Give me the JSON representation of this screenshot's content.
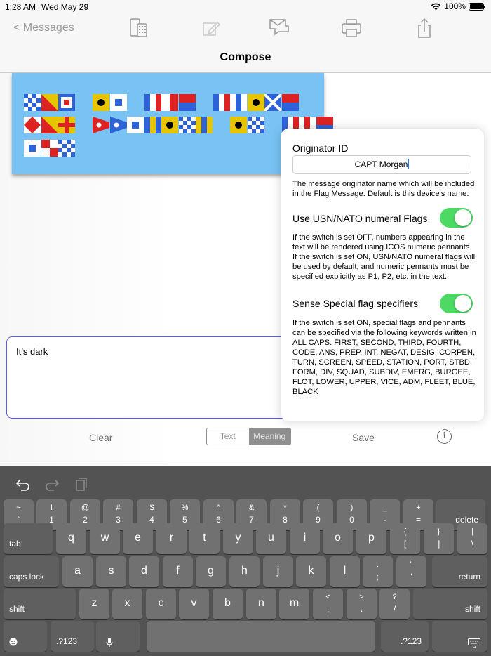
{
  "status": {
    "time": "1:28 AM",
    "date": "Wed May 29",
    "battery": "100%"
  },
  "nav": {
    "back": "< Messages",
    "title": "Compose"
  },
  "flags": [
    [
      [
        "diamond",
        "#2d62d8",
        "#fff"
      ],
      [
        "diagonal",
        "#e6c400",
        "#d22"
      ],
      [
        "squares",
        "#d22",
        "#fff"
      ],
      null,
      [
        "dot",
        "#e6c400",
        "#000"
      ],
      [
        "square",
        "#fff",
        "#2d62d8"
      ],
      null,
      [
        "vstripes3",
        "#2d62d8",
        "#fff",
        "#d22"
      ],
      [
        "vstripes2",
        "#fff",
        "#d22"
      ],
      [
        "halves",
        "#d22",
        "#2d62d8"
      ],
      null,
      [
        "vstripes3",
        "#2d62d8",
        "#fff",
        "#d22"
      ],
      [
        "vstripes3",
        "#fff",
        "#2d62d8",
        "#fff"
      ],
      [
        "dot",
        "#e6c400",
        "#000"
      ],
      [
        "saltire",
        "#2d62d8",
        "#fff"
      ],
      [
        "halves",
        "#d22",
        "#2d62d8"
      ]
    ],
    [
      [
        "diamond2",
        "#fff",
        "#d22"
      ],
      [
        "diagonal",
        "#e6c400",
        "#d22"
      ],
      [
        "cross",
        "#e6c400",
        "#d22"
      ],
      null,
      [
        "pennant",
        "#d22",
        "#fff"
      ],
      [
        "pennant",
        "#2d62d8",
        "#fff"
      ],
      [
        "square",
        "#fff",
        "#2d62d8"
      ],
      [
        "vstripes3",
        "#2d62d8",
        "#e6c400",
        "#2d62d8"
      ],
      [
        "dot",
        "#e6c400",
        "#000"
      ],
      [
        "diamond",
        "#2d62d8",
        "#fff"
      ],
      [
        "vstripes3",
        "#e6c400",
        "#2d62d8",
        "#e6c400"
      ],
      null,
      [
        "dot",
        "#e6c400",
        "#000"
      ],
      [
        "diamond",
        "#2d62d8",
        "#fff"
      ],
      null,
      [
        "vstripes3",
        "#2d62d8",
        "#fff",
        "#d22"
      ],
      [
        "vstripes3",
        "#fff",
        "#d22",
        "#fff"
      ],
      [
        "halves",
        "#d22",
        "#2d62d8"
      ]
    ],
    [
      [
        "square",
        "#fff",
        "#2d62d8"
      ],
      [
        "quarters",
        "#d22",
        "#fff"
      ],
      [
        "diamond",
        "#2d62d8",
        "#fff"
      ]
    ]
  ],
  "message": {
    "text": "It’s dark"
  },
  "controls": {
    "clear": "Clear",
    "seg_text": "Text",
    "seg_meaning": "Meaning",
    "save": "Save",
    "info": "i"
  },
  "settings": {
    "originator_label": "Originator ID",
    "originator_value": "CAPT Morgan",
    "originator_desc": "The message originator name which will be included in the Flag Message.  Default is this device's name.",
    "numeral_label": "Use USN/NATO numeral Flags",
    "numeral_on": true,
    "numeral_desc": "If the switch is set OFF, numbers appearing in the text will be rendered using ICOS numeric pennants.  If the switch is set ON, USN/NATO numeral flags will be used by default, and numeric pennants must be specified explicitly as P1, P2, etc. in the text.",
    "special_label": "Sense Special flag specifiers",
    "special_on": true,
    "special_desc": "If the switch is set ON, special flags and pennants can be specified via the following keywords written in ALL CAPS: FIRST, SECOND, THIRD, FOURTH, CODE, ANS, PREP, INT, NEGAT, DESIG, CORPEN, TURN, SCREEN, SPEED, STATION, PORT, STBD, FORM, DIV, SQUAD, SUBDIV, EMERG, BURGEE, FLOT, LOWER, UPPER, VICE, ADM, FLEET, BLUE, BLACK"
  },
  "keyboard": {
    "tools": [
      "undo-icon",
      "redo-icon",
      "paste-icon"
    ],
    "rows": [
      [
        [
          "~",
          "`"
        ],
        [
          "!",
          "1"
        ],
        [
          "@",
          "2"
        ],
        [
          "#",
          "3"
        ],
        [
          "$",
          "4"
        ],
        [
          "%",
          "5"
        ],
        [
          "^",
          "6"
        ],
        [
          "&",
          "7"
        ],
        [
          "*",
          "8"
        ],
        [
          "(",
          "9"
        ],
        [
          ")",
          "0"
        ],
        [
          "_",
          "-"
        ],
        [
          "+",
          "="
        ],
        [
          "delete"
        ]
      ],
      [
        [
          "tab"
        ],
        [
          "q"
        ],
        [
          "w"
        ],
        [
          "e"
        ],
        [
          "r"
        ],
        [
          "t"
        ],
        [
          "y"
        ],
        [
          "u"
        ],
        [
          "i"
        ],
        [
          "o"
        ],
        [
          "p"
        ],
        [
          "{",
          "["
        ],
        [
          "}",
          "]"
        ],
        [
          "|",
          "\\"
        ]
      ],
      [
        [
          "caps lock"
        ],
        [
          "a"
        ],
        [
          "s"
        ],
        [
          "d"
        ],
        [
          "f"
        ],
        [
          "g"
        ],
        [
          "h"
        ],
        [
          "j"
        ],
        [
          "k"
        ],
        [
          "l"
        ],
        [
          ":",
          ";"
        ],
        [
          "”",
          "'"
        ],
        [
          "return"
        ]
      ],
      [
        [
          "shift"
        ],
        [
          "z"
        ],
        [
          "x"
        ],
        [
          "c"
        ],
        [
          "v"
        ],
        [
          "b"
        ],
        [
          "n"
        ],
        [
          "m"
        ],
        [
          "<",
          ","
        ],
        [
          ">",
          "."
        ],
        [
          "?",
          "/"
        ],
        [
          "shift"
        ]
      ],
      [
        [
          "emoji"
        ],
        [
          ".?123"
        ],
        [
          "mic"
        ],
        [
          " "
        ],
        [
          ".?123"
        ],
        [
          "keyboard-hide"
        ]
      ]
    ]
  },
  "colors": {
    "accent": "#4cd964",
    "flag_panel": "#78c3f3",
    "input_border": "#5a5aff"
  }
}
